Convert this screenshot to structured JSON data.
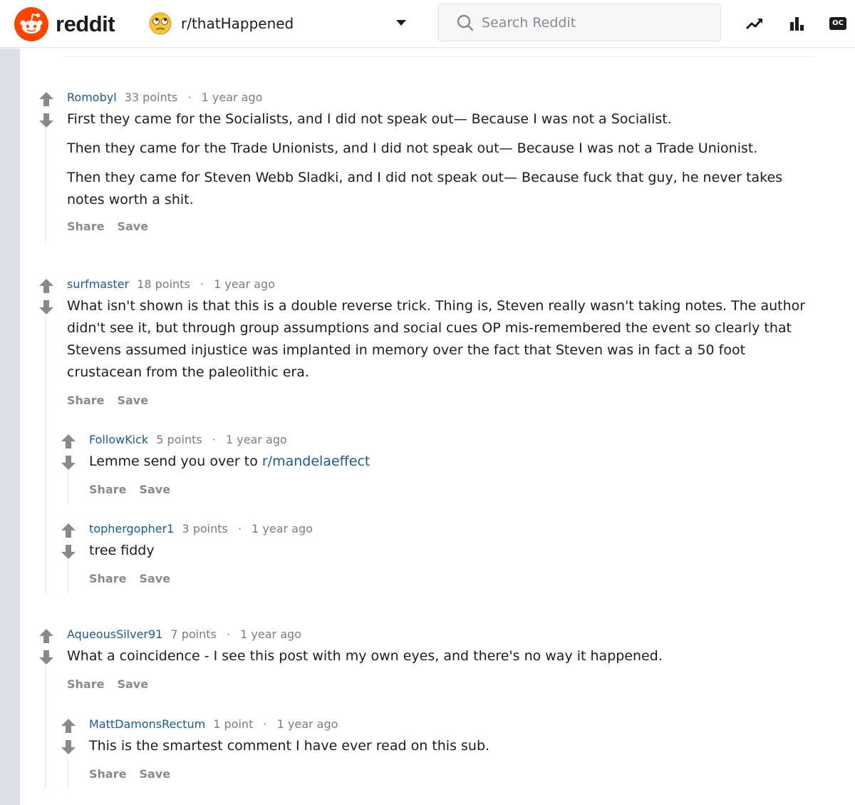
{
  "header": {
    "logo_text": "reddit",
    "subreddit": "r/thatHappened",
    "search_placeholder": "Search Reddit",
    "icons": [
      "trending-icon",
      "leaderboard-icon",
      "oc-icon"
    ],
    "oc_label": "OC"
  },
  "colors": {
    "brand": "#ff4500",
    "link": "#1a5a8c",
    "meta": "#7c7c7c",
    "action": "#878a8c",
    "gutter": "#dae0e6"
  },
  "actions": {
    "share": "Share",
    "save": "Save"
  },
  "comments": [
    {
      "author": "Romobyl",
      "points": "33 points",
      "sep": "·",
      "time": "1 year ago",
      "paragraphs": [
        "First they came for the Socialists, and I did not speak out— Because I was not a Socialist.",
        "Then they came for the Trade Unionists, and I did not speak out— Because I was not a Trade Unionist.",
        "Then they came for Steven Webb Sladki, and I did not speak out— Because fuck that guy, he never takes notes worth a shit."
      ]
    },
    {
      "author": "surfmaster",
      "points": "18 points",
      "sep": "·",
      "time": "1 year ago",
      "paragraphs": [
        "What isn't shown is that this is a double reverse trick. Thing is, Steven really wasn't taking notes. The author didn't see it, but through group assumptions and social cues OP mis-remembered the event so clearly that Stevens assumed injustice was implanted in memory over the fact that Steven was in fact a 50 foot crustacean from the paleolithic era."
      ]
    },
    {
      "author": "FollowKick",
      "points": "5 points",
      "sep": "·",
      "time": "1 year ago",
      "text_before_link": "Lemme send you over to ",
      "link": "r/mandelaeffect"
    },
    {
      "author": "tophergopher1",
      "points": "3 points",
      "sep": "·",
      "time": "1 year ago",
      "paragraphs": [
        "tree fiddy"
      ]
    },
    {
      "author": "AqueousSilver91",
      "points": "7 points",
      "sep": "·",
      "time": "1 year ago",
      "paragraphs": [
        "What a coincidence - I see this post with my own eyes, and there's no way it happened."
      ]
    },
    {
      "author": "MattDamonsRectum",
      "points": "1 point",
      "sep": "·",
      "time": "1 year ago",
      "paragraphs": [
        "This is the smartest comment I have ever read on this sub."
      ]
    }
  ]
}
